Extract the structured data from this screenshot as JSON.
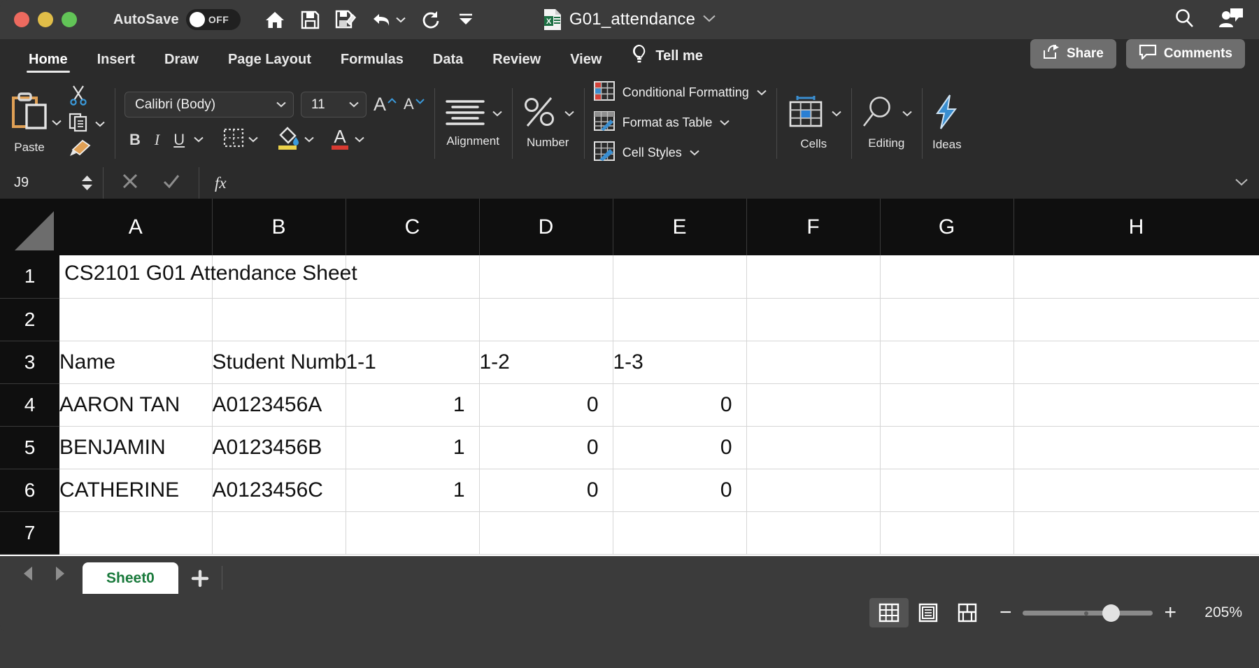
{
  "window": {
    "autosave_label": "AutoSave",
    "autosave_state": "OFF",
    "doc_title": "G01_attendance",
    "traffic_lights": [
      "close",
      "minimize",
      "maximize"
    ],
    "quick_access": [
      {
        "name": "home-icon",
        "label": "Home"
      },
      {
        "name": "save-icon",
        "label": "Save"
      },
      {
        "name": "save-as-icon",
        "label": "Save As"
      },
      {
        "name": "undo-icon",
        "label": "Undo"
      },
      {
        "name": "redo-icon",
        "label": "Redo"
      },
      {
        "name": "customize-toolbar-icon",
        "label": "Customize Quick Access Toolbar"
      }
    ],
    "right_icons": [
      {
        "name": "search-icon",
        "label": "Search"
      },
      {
        "name": "account-icon",
        "label": "Account"
      }
    ]
  },
  "ribbon": {
    "tabs": [
      {
        "label": "Home",
        "active": true
      },
      {
        "label": "Insert",
        "active": false
      },
      {
        "label": "Draw",
        "active": false
      },
      {
        "label": "Page Layout",
        "active": false
      },
      {
        "label": "Formulas",
        "active": false
      },
      {
        "label": "Data",
        "active": false
      },
      {
        "label": "Review",
        "active": false
      },
      {
        "label": "View",
        "active": false
      }
    ],
    "tell_me": "Tell me",
    "share": "Share",
    "comments": "Comments",
    "clipboard": {
      "paste_label": "Paste",
      "cut_label": "Cut",
      "copy_label": "Copy",
      "format_painter_label": "Format Painter"
    },
    "font": {
      "family": "Calibri (Body)",
      "size": "11",
      "bold": "B",
      "italic": "I",
      "underline": "U",
      "grow_font": "A",
      "shrink_font": "A",
      "borders_label": "Borders",
      "fill_color_label": "Fill Color",
      "font_color_label": "Font Color"
    },
    "alignment_label": "Alignment",
    "number_label": "Number",
    "styles": {
      "conditional_formatting": "Conditional Formatting",
      "format_as_table": "Format as Table",
      "cell_styles": "Cell Styles"
    },
    "cells_label": "Cells",
    "editing_label": "Editing",
    "ideas_label": "Ideas"
  },
  "formula_bar": {
    "name_box": "J9",
    "cancel_label": "Cancel",
    "enter_label": "Enter",
    "fx_label": "fx",
    "formula_value": "",
    "formula_placeholder": ""
  },
  "sheet": {
    "columns": [
      "A",
      "B",
      "C",
      "D",
      "E",
      "F",
      "G",
      "H"
    ],
    "rows": [
      "1",
      "2",
      "3",
      "4",
      "5",
      "6",
      "7"
    ],
    "cells": [
      [
        "CS2101 G01 Attendance Sheet",
        "",
        "",
        "",
        "",
        "",
        "",
        ""
      ],
      [
        "",
        "",
        "",
        "",
        "",
        "",
        "",
        ""
      ],
      [
        "Name",
        "Student Number",
        "1-1",
        "1-2",
        "1-3",
        "",
        "",
        ""
      ],
      [
        "AARON TAN",
        "A0123456A",
        "1",
        "0",
        "0",
        "",
        "",
        ""
      ],
      [
        "BENJAMIN",
        "A0123456B",
        "1",
        "0",
        "0",
        "",
        "",
        ""
      ],
      [
        "CATHERINE",
        "A0123456C",
        "1",
        "0",
        "0",
        "",
        "",
        ""
      ],
      [
        "",
        "",
        "",
        "",
        "",
        "",
        "",
        ""
      ]
    ],
    "selected_cell": "J9"
  },
  "sheet_tabs": {
    "tabs": [
      {
        "label": "Sheet0",
        "active": true
      }
    ],
    "add_label": "+",
    "prev_label": "Previous Sheet",
    "next_label": "Next Sheet"
  },
  "status_bar": {
    "views": [
      {
        "name": "normal-view-icon",
        "label": "Normal",
        "active": true
      },
      {
        "name": "page-layout-view-icon",
        "label": "Page Layout",
        "active": false
      },
      {
        "name": "page-break-view-icon",
        "label": "Page Break Preview",
        "active": false
      }
    ],
    "zoom_out": "−",
    "zoom_in": "+",
    "zoom_level": "205%"
  },
  "colors": {
    "chrome": "#3b3b3b",
    "ribbon": "#2b2b2b",
    "grid_header": "#0f0f0f",
    "accent_green": "#1a7a3c",
    "accent_blue": "#2a7fd4",
    "paste_orange": "#e0a055"
  }
}
